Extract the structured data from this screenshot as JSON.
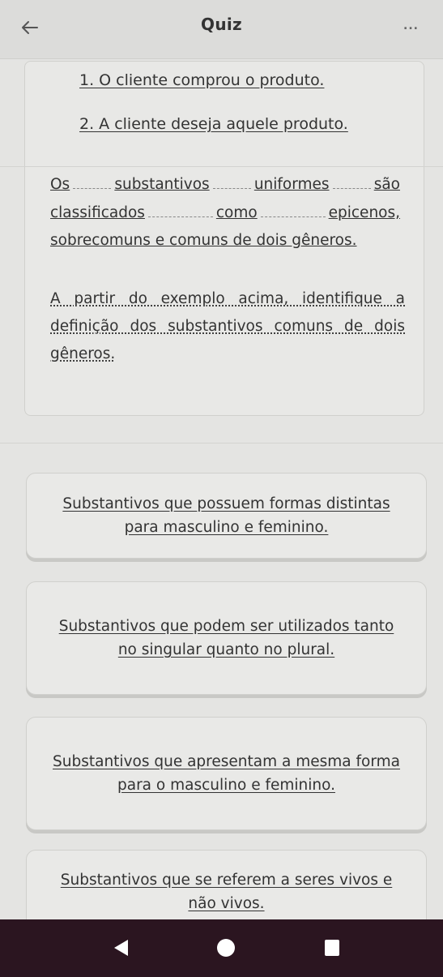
{
  "header": {
    "title": "Quiz",
    "back_icon": "arrow-left-icon",
    "more_label": "..."
  },
  "question": {
    "sentences": [
      "1. O cliente comprou o produto.",
      "2. A cliente deseja aquele produto."
    ],
    "lines": [
      [
        "Os",
        "substantivos",
        "uniformes",
        "são"
      ],
      [
        "classificados",
        "como",
        "epicenos,"
      ],
      [
        "sobrecomuns e comuns de dois gêneros."
      ]
    ],
    "prompt": "A partir do exemplo acima, identifique a definição dos substantivos comuns de dois gêneros."
  },
  "options": [
    {
      "label": "Substantivos que possuem formas distintas para masculino e feminino."
    },
    {
      "label": "Substantivos que podem ser utilizados tanto no singular quanto no plural."
    },
    {
      "label": "Substantivos que apresentam a mesma forma para o masculino e feminino."
    },
    {
      "label": "Substantivos que se referem a seres vivos e não vivos."
    }
  ],
  "navbar": {
    "back_icon": "triangle-back-icon",
    "home_icon": "circle-home-icon",
    "recents_icon": "square-recents-icon"
  },
  "colors": {
    "background": "#e4e4e2",
    "navbar": "#2b1520",
    "text": "#333333"
  }
}
